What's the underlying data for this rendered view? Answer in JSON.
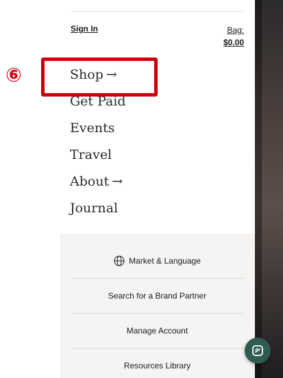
{
  "header": {
    "sign_in_label": "Sign In",
    "bag_label": "Bag:",
    "bag_amount": "$0.00"
  },
  "nav": {
    "items": [
      {
        "label": "Shop",
        "arrow": "→"
      },
      {
        "label": "Get Paid"
      },
      {
        "label": "Events"
      },
      {
        "label": "Travel"
      },
      {
        "label": "About",
        "arrow": "→"
      },
      {
        "label": "Journal"
      }
    ]
  },
  "panel": {
    "market_language": "Market & Language",
    "search_brand_partner": "Search for a Brand Partner",
    "manage_account": "Manage Account",
    "resources_library": "Resources Library"
  },
  "annotation": {
    "number": "⑥"
  },
  "colors": {
    "annotation_red": "#c8000a",
    "panel_bg": "#f5f4f3",
    "chat_fab": "#2f5b50"
  },
  "icons": {
    "globe": "globe-icon",
    "chat": "chat-icon",
    "arrow": "arrow-right-icon"
  }
}
